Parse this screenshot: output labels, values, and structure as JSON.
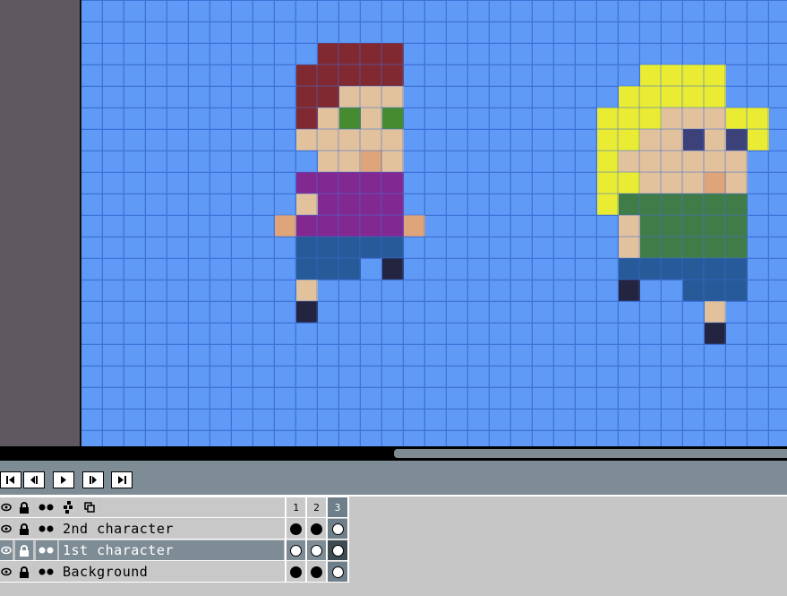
{
  "timeline": {
    "buttons": [
      {
        "name": "first-frame-button",
        "icon": "skip-to-start-icon"
      },
      {
        "name": "previous-frame-button",
        "icon": "step-back-icon"
      },
      {
        "name": "play-button",
        "icon": "play-icon"
      },
      {
        "name": "next-frame-button",
        "icon": "step-forward-icon"
      },
      {
        "name": "last-frame-button",
        "icon": "skip-to-end-icon"
      }
    ]
  },
  "layers": {
    "header_icons": [
      "eye-icon",
      "lock-icon",
      "onion-skin-icon",
      "link-icon",
      "continuous-icon"
    ],
    "frame_numbers": [
      "1",
      "2",
      "3"
    ],
    "current_frame": "3",
    "rows": [
      {
        "name": "2nd character",
        "selected": false,
        "cels": [
          "filled",
          "filled",
          "empty"
        ]
      },
      {
        "name": "1st character",
        "selected": true,
        "cels": [
          "empty",
          "empty",
          "empty"
        ]
      },
      {
        "name": "Background",
        "selected": false,
        "cels": [
          "filled",
          "filled",
          "empty"
        ]
      }
    ]
  },
  "colors": {
    "canvas_bg": "#5f9af6",
    "grid": "#3f72d8",
    "toolbar": "#7e8c96",
    "panel": "#c8c8c8"
  }
}
